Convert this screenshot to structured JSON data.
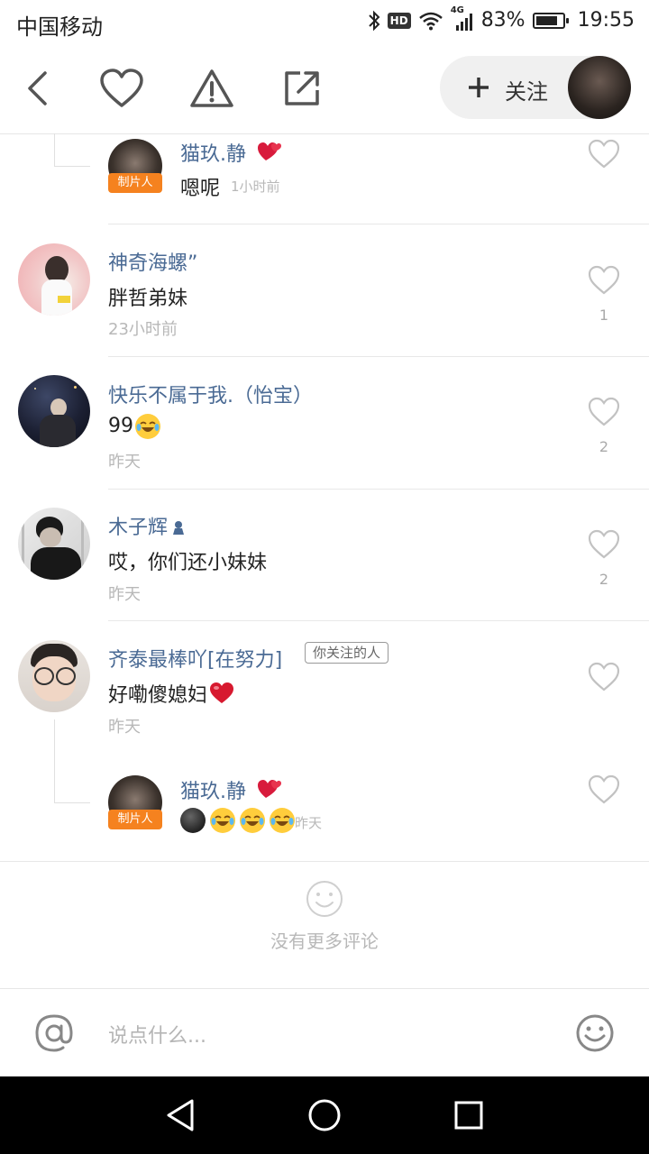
{
  "status_bar": {
    "carrier": "中国移动",
    "network_badge": "HD",
    "signal_label": "4G",
    "battery_percent": "83%",
    "battery_level": 0.83,
    "time": "19:55"
  },
  "top_bar": {
    "icons": [
      "back-icon",
      "heart-icon",
      "warning-icon",
      "share-icon"
    ],
    "follow_label": "关注"
  },
  "comments": [
    {
      "kind": "reply",
      "name": "猫玖.静",
      "badge": "制片人",
      "text": "嗯呢",
      "time": "1小时前"
    },
    {
      "kind": "comment",
      "name": "神奇海螺”",
      "text": "胖哲弟妹",
      "time": "23小时前",
      "likes": "1"
    },
    {
      "kind": "comment",
      "name": "快乐不属于我.（怡宝）",
      "text": "99",
      "emoji": [
        "laugh-cry-emoji"
      ],
      "time": "昨天",
      "likes": "2"
    },
    {
      "kind": "comment",
      "name": "木子辉",
      "text": "哎，你们还小妹妹",
      "time": "昨天",
      "likes": "2"
    },
    {
      "kind": "comment",
      "name": "齐泰最棒吖[在努力]",
      "tag": "你关注的人",
      "text": "好嘞傻媳妇",
      "emoji": [
        "red-heart-emoji"
      ],
      "time": "昨天"
    },
    {
      "kind": "reply",
      "name": "猫玖.静",
      "badge": "制片人",
      "emoji": [
        "dark-face-emoji",
        "laugh-cry-emoji",
        "laugh-cry-emoji",
        "laugh-cry-emoji"
      ],
      "time": "昨天"
    }
  ],
  "footer": {
    "no_more": "没有更多评论"
  },
  "input_bar": {
    "placeholder": "说点什么..."
  },
  "colors": {
    "name_blue": "#4a6a94",
    "badge_orange": "#f5821f",
    "divider": "#e8e8e8",
    "nav_black": "#000000"
  }
}
